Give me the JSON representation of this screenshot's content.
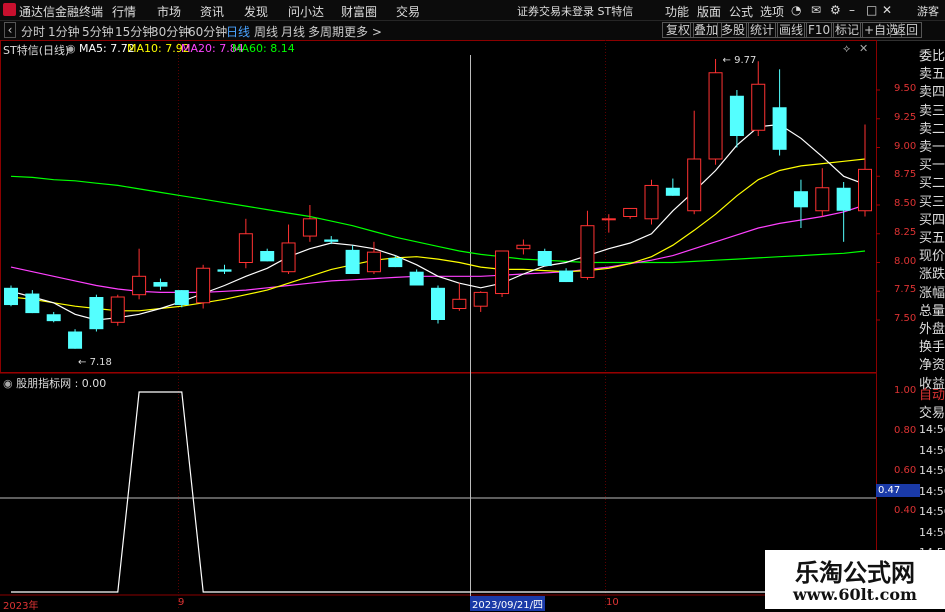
{
  "menubar": {
    "app_title": "通达信金融终端",
    "items": [
      "行情",
      "市场",
      "资讯",
      "发现",
      "问小达",
      "财富圈",
      "交易"
    ],
    "status_warning": "证券交易未登录  ST特信",
    "right_items": [
      "功能",
      "版面",
      "公式",
      "选项"
    ],
    "guest": "游客"
  },
  "toolbar": {
    "periods": [
      "分时",
      "1分钟",
      "5分钟",
      "15分钟",
      "30分钟",
      "60分钟",
      "日线",
      "周线",
      "月线",
      "多周期",
      "更多 >"
    ],
    "active_period": "日线",
    "right_buttons": [
      "复权",
      "叠加",
      "多股",
      "统计",
      "画线",
      "F10",
      "标记",
      "+自选",
      "返回"
    ]
  },
  "chart_header": {
    "stock": "ST特信(日线)",
    "ma5": "MA5: 7.72",
    "ma10": "MA10: 7.92",
    "ma20": "MA20: 7.84",
    "ma60": "MA60: 8.14"
  },
  "colors": {
    "up": "#ff3232",
    "down": "#54ffff",
    "ma5": "#ffffff",
    "ma10": "#ffff00",
    "ma20": "#ff40ff",
    "ma60": "#00ff00",
    "grid": "#8b0000"
  },
  "price_axis": [
    "9.50",
    "9.25",
    "9.00",
    "8.75",
    "8.50",
    "8.25",
    "8.00",
    "7.75",
    "7.50"
  ],
  "indicator": {
    "title": "股朋指标网 : 0.00",
    "axis": [
      "1.00",
      "0.80",
      "0.60",
      "0.40"
    ],
    "cursor_value": "0.47"
  },
  "right_panel": {
    "labels": [
      "委比",
      "卖五",
      "卖四",
      "卖三",
      "卖二",
      "卖一",
      "买一",
      "买二",
      "买三",
      "买四",
      "买五",
      "现价",
      "涨跌",
      "涨幅",
      "总量",
      "外盘",
      "换手",
      "净资",
      "收益"
    ],
    "lower": [
      "自动",
      "交易"
    ],
    "times": [
      "14:56",
      "14:56",
      "14:56",
      "14:56",
      "14:56",
      "14:56",
      "14:56",
      "14:56"
    ]
  },
  "x_axis": {
    "labels": [
      "2023年",
      "9",
      "2023/09/21/四",
      "10"
    ]
  },
  "chart_data": {
    "type": "candlestick",
    "annotations": [
      "9.77",
      "7.18"
    ],
    "candles": [
      {
        "o": 7.78,
        "h": 7.8,
        "l": 7.62,
        "c": 7.63
      },
      {
        "o": 7.73,
        "h": 7.76,
        "l": 7.56,
        "c": 7.56
      },
      {
        "o": 7.55,
        "h": 7.57,
        "l": 7.48,
        "c": 7.49
      },
      {
        "o": 7.4,
        "h": 7.42,
        "l": 7.25,
        "c": 7.25
      },
      {
        "o": 7.7,
        "h": 7.72,
        "l": 7.4,
        "c": 7.42
      },
      {
        "o": 7.48,
        "h": 7.72,
        "l": 7.45,
        "c": 7.7
      },
      {
        "o": 7.72,
        "h": 8.12,
        "l": 7.68,
        "c": 7.88
      },
      {
        "o": 7.83,
        "h": 7.86,
        "l": 7.76,
        "c": 7.79
      },
      {
        "o": 7.76,
        "h": 7.76,
        "l": 7.61,
        "c": 7.63
      },
      {
        "o": 7.65,
        "h": 7.98,
        "l": 7.6,
        "c": 7.95
      },
      {
        "o": 7.94,
        "h": 7.98,
        "l": 7.9,
        "c": 7.92
      },
      {
        "o": 8.0,
        "h": 8.38,
        "l": 7.95,
        "c": 8.25
      },
      {
        "o": 8.1,
        "h": 8.12,
        "l": 8.01,
        "c": 8.01
      },
      {
        "o": 7.92,
        "h": 8.33,
        "l": 7.9,
        "c": 8.17
      },
      {
        "o": 8.23,
        "h": 8.5,
        "l": 8.18,
        "c": 8.38
      },
      {
        "o": 8.2,
        "h": 8.23,
        "l": 8.16,
        "c": 8.18
      },
      {
        "o": 8.11,
        "h": 8.15,
        "l": 7.9,
        "c": 7.9
      },
      {
        "o": 7.92,
        "h": 8.18,
        "l": 7.9,
        "c": 8.09
      },
      {
        "o": 8.04,
        "h": 8.06,
        "l": 7.96,
        "c": 7.96
      },
      {
        "o": 7.92,
        "h": 7.94,
        "l": 7.8,
        "c": 7.8
      },
      {
        "o": 7.78,
        "h": 7.8,
        "l": 7.47,
        "c": 7.5
      },
      {
        "o": 7.6,
        "h": 7.82,
        "l": 7.58,
        "c": 7.68
      },
      {
        "o": 7.62,
        "h": 7.75,
        "l": 7.57,
        "c": 7.74
      },
      {
        "o": 7.73,
        "h": 8.08,
        "l": 7.7,
        "c": 8.1
      },
      {
        "o": 8.12,
        "h": 8.2,
        "l": 8.07,
        "c": 8.15
      },
      {
        "o": 8.1,
        "h": 8.12,
        "l": 7.97,
        "c": 7.97
      },
      {
        "o": 7.93,
        "h": 7.95,
        "l": 7.83,
        "c": 7.83
      },
      {
        "o": 7.87,
        "h": 8.45,
        "l": 7.85,
        "c": 8.32
      },
      {
        "o": 8.38,
        "h": 8.42,
        "l": 8.26,
        "c": 8.38
      },
      {
        "o": 8.4,
        "h": 8.45,
        "l": 8.38,
        "c": 8.47
      },
      {
        "o": 8.38,
        "h": 8.72,
        "l": 8.33,
        "c": 8.67
      },
      {
        "o": 8.65,
        "h": 8.73,
        "l": 8.58,
        "c": 8.58
      },
      {
        "o": 8.45,
        "h": 9.32,
        "l": 8.42,
        "c": 8.9
      },
      {
        "o": 8.9,
        "h": 9.77,
        "l": 8.85,
        "c": 9.65
      },
      {
        "o": 9.45,
        "h": 9.5,
        "l": 9.0,
        "c": 9.1
      },
      {
        "o": 9.15,
        "h": 9.75,
        "l": 9.1,
        "c": 9.55
      },
      {
        "o": 9.35,
        "h": 9.68,
        "l": 8.93,
        "c": 8.98
      },
      {
        "o": 8.62,
        "h": 8.72,
        "l": 8.3,
        "c": 8.48
      },
      {
        "o": 8.45,
        "h": 8.82,
        "l": 8.4,
        "c": 8.65
      },
      {
        "o": 8.65,
        "h": 8.7,
        "l": 8.18,
        "c": 8.45
      },
      {
        "o": 8.45,
        "h": 9.2,
        "l": 8.4,
        "c": 8.81
      }
    ],
    "ma5": [
      7.75,
      7.7,
      7.65,
      7.55,
      7.5,
      7.52,
      7.55,
      7.6,
      7.66,
      7.73,
      7.8,
      7.88,
      7.95,
      8.05,
      8.12,
      8.17,
      8.15,
      8.12,
      8.06,
      7.98,
      7.88,
      7.82,
      7.78,
      7.82,
      7.9,
      7.97,
      8.0,
      8.06,
      8.12,
      8.17,
      8.25,
      8.45,
      8.62,
      8.8,
      9.02,
      9.18,
      9.2,
      9.08,
      8.92,
      8.75,
      8.68
    ],
    "ma10": [
      7.7,
      7.68,
      7.65,
      7.62,
      7.6,
      7.58,
      7.58,
      7.6,
      7.62,
      7.65,
      7.68,
      7.72,
      7.76,
      7.82,
      7.88,
      7.94,
      7.98,
      8.02,
      8.04,
      8.05,
      8.03,
      8.0,
      7.96,
      7.94,
      7.94,
      7.93,
      7.92,
      7.93,
      7.95,
      7.99,
      8.05,
      8.15,
      8.28,
      8.42,
      8.58,
      8.72,
      8.8,
      8.84,
      8.86,
      8.88,
      8.9
    ],
    "ma20": [
      7.96,
      7.92,
      7.88,
      7.84,
      7.8,
      7.77,
      7.75,
      7.74,
      7.74,
      7.74,
      7.75,
      7.76,
      7.78,
      7.8,
      7.82,
      7.84,
      7.85,
      7.86,
      7.87,
      7.88,
      7.88,
      7.88,
      7.88,
      7.89,
      7.9,
      7.91,
      7.92,
      7.94,
      7.96,
      7.99,
      8.02,
      8.06,
      8.12,
      8.18,
      8.24,
      8.3,
      8.34,
      8.37,
      8.4,
      8.44,
      8.5
    ],
    "ma60": [
      8.75,
      8.74,
      8.72,
      8.71,
      8.69,
      8.67,
      8.64,
      8.61,
      8.58,
      8.55,
      8.52,
      8.49,
      8.46,
      8.43,
      8.4,
      8.36,
      8.32,
      8.27,
      8.22,
      8.18,
      8.14,
      8.1,
      8.07,
      8.05,
      8.03,
      8.02,
      8.01,
      8.0,
      8.0,
      8.0,
      8.0,
      8.0,
      8.01,
      8.02,
      8.03,
      8.04,
      8.05,
      8.06,
      8.07,
      8.08,
      8.1
    ],
    "indicator_series": [
      0,
      0,
      0,
      0,
      0,
      0,
      1,
      1,
      1,
      0,
      0,
      0,
      0,
      0,
      0,
      0,
      0,
      0,
      0,
      0,
      0,
      0,
      0,
      0,
      0,
      0,
      0,
      0,
      0,
      0,
      0,
      0,
      0,
      0,
      0,
      0,
      0,
      0,
      0,
      0,
      0
    ],
    "ylim_price": [
      7.18,
      9.9
    ],
    "ylim_indicator": [
      0,
      1.0
    ]
  },
  "watermark": {
    "cn": "乐淘公式网",
    "url": "www.60lt.com"
  }
}
